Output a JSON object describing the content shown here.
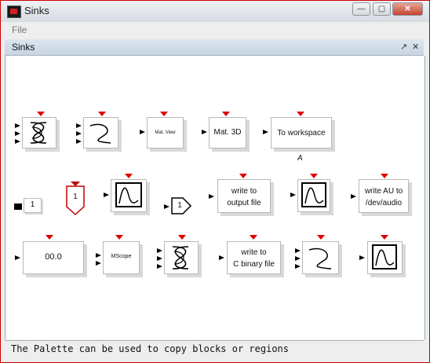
{
  "window": {
    "title": "Sinks",
    "min_label": "—",
    "max_label": "▢",
    "close_label": "✕"
  },
  "menu": {
    "file_label": "File"
  },
  "palette": {
    "title": "Sinks",
    "undock_label": "↗",
    "close_label": "✕"
  },
  "blocks": {
    "matview": "Mat. View",
    "mat3d": "Mat. 3D",
    "toworkspace": "To workspace",
    "toworkspace_var": "A",
    "const_val": "1",
    "shield_val": "1",
    "pent_val": "1",
    "writefile_l1": "write to",
    "writefile_l2": "output file",
    "writeau_l1": "write AU to",
    "writeau_l2": "/dev/audio",
    "display_val": "00.0",
    "mscope": "MScope",
    "writec_l1": "write to",
    "writec_l2": "C binary file"
  },
  "status": {
    "text": "The Palette can be used to copy blocks or regions"
  },
  "colors": {
    "port_event": "#e00000",
    "title_border": "#cc0000"
  }
}
